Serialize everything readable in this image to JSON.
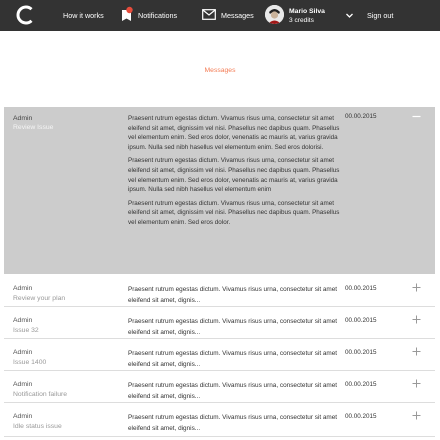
{
  "nav": {
    "how_it_works": "How it works",
    "notifications": "Notifications",
    "messages": "Messages",
    "sign_out": "Sign out",
    "user_name": "Mario Silva",
    "user_credits": "3 credits",
    "icons": [
      "logo-icon",
      "bell-icon",
      "envelope-icon",
      "chevron-down-icon"
    ],
    "notification_dot_color": "#e74c3c"
  },
  "page": {
    "title": "Messages",
    "accent_color": "#f47c55"
  },
  "open_message": {
    "sender": "Admin",
    "subject": "Review Issue",
    "date": "00.00.2015",
    "paragraphs": [
      "Praesent rutrum egestas dictum. Vivamus risus urna, consectetur sit amet eleifend sit amet, dignissim vel nisi. Phasellus nec dapibus quam. Phasellus vel elementum enim. Sed eros dolor, venenatis ac mauris at, varius gravida ipsum. Nulla sed nibh hasellus vel elementum enim. Sed eros dolorisi.",
      "Praesent rutrum egestas dictum. Vivamus risus urna, consectetur sit amet eleifend sit amet, dignissim vel nisi. Phasellus nec dapibus quam. Phasellus vel elementum enim. Sed eros dolor, venenatis ac mauris at, varius gravida ipsum. Nulla sed nibh hasellus vel elementum enim",
      "Praesent rutrum egestas dictum. Vivamus risus urna, consectetur sit amet eleifend sit amet, dignissim vel nisi. Phasellus nec dapibus quam. Phasellus vel elementum enim. Sed eros dolor."
    ]
  },
  "messages": [
    {
      "sender": "Admin",
      "subject": "Review your plan",
      "date": "00.00.2015",
      "preview": "Praesent rutrum egestas dictum. Vivamus risus urna, consectetur sit amet eleifend sit amet, dignis..."
    },
    {
      "sender": "Admin",
      "subject": "Issue 32",
      "date": "00.00.2015",
      "preview": "Praesent rutrum egestas dictum. Vivamus risus urna, consectetur sit amet eleifend sit amet, dignis..."
    },
    {
      "sender": "Admin",
      "subject": "Issue 1400",
      "date": "00.00.2015",
      "preview": "Praesent rutrum egestas dictum. Vivamus risus urna, consectetur sit amet eleifend sit amet, dignis..."
    },
    {
      "sender": "Admin",
      "subject": "Notification failure",
      "date": "00.00.2015",
      "preview": "Praesent rutrum egestas dictum. Vivamus risus urna, consectetur sit amet eleifend sit amet, dignis..."
    },
    {
      "sender": "Admin",
      "subject": "Idle status issue",
      "date": "00.00.2015",
      "preview": "Praesent rutrum egestas dictum. Vivamus risus urna, consectetur sit amet eleifend sit amet, dignis..."
    }
  ]
}
